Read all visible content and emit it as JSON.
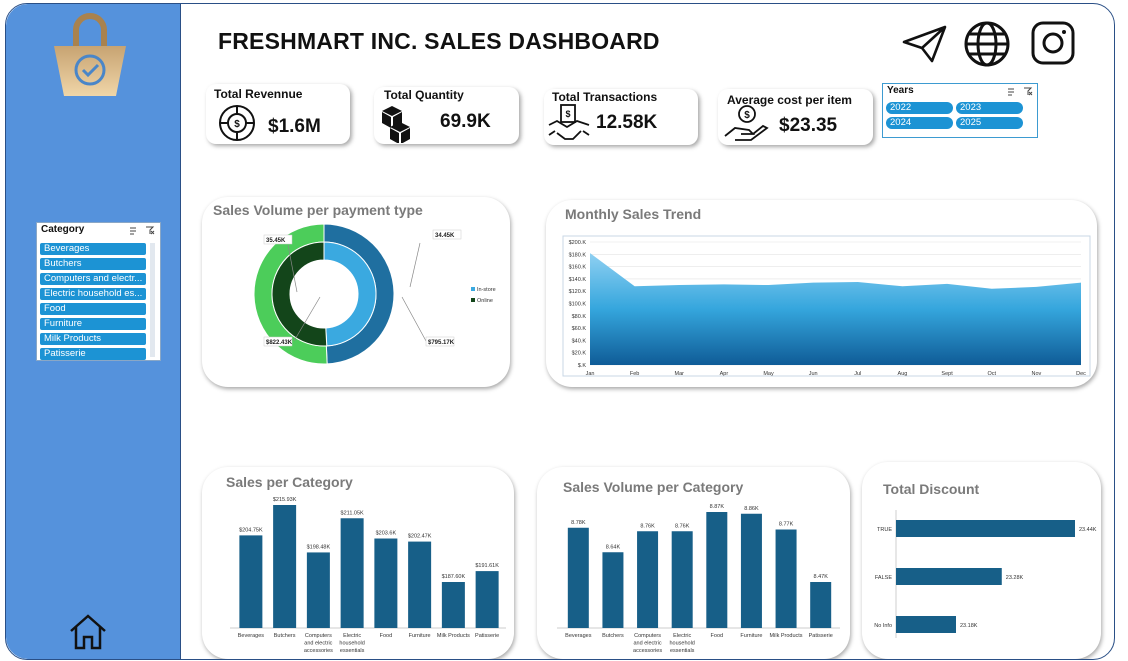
{
  "title": "FRESHMART INC. SALES DASHBOARD",
  "kpis": {
    "revenue": {
      "label": "Total Revennue",
      "value": "$1.6M"
    },
    "quantity": {
      "label": "Total Quantity",
      "value": "69.9K"
    },
    "transactions": {
      "label": "Total Transactions",
      "value": "12.58K"
    },
    "avg_cost": {
      "label": "Average cost per item",
      "value": "$23.35"
    }
  },
  "years_slicer": {
    "title": "Years",
    "items": [
      "2022",
      "2023",
      "2024",
      "2025"
    ]
  },
  "category_slicer": {
    "title": "Category",
    "items": [
      "Beverages",
      "Butchers",
      "Computers and electr...",
      "Electric household es...",
      "Food",
      "Furniture",
      "Milk Products",
      "Patisserie"
    ]
  },
  "icons": {
    "cart": "shopping-bag-icon",
    "send": "paper-plane-icon",
    "web": "globe-icon",
    "social": "instagram-icon",
    "home": "home-icon"
  },
  "colors": {
    "sidebar": "#5592dc",
    "bar": "#175f88",
    "instore": "#1f6fa0",
    "instore_light": "#3aa9e0",
    "online": "#4ccd5a",
    "online_dark": "#13451a"
  },
  "chart_data": [
    {
      "id": "payment",
      "type": "pie",
      "title": "Sales Volume per payment type",
      "legend": [
        "In-store",
        "Online"
      ],
      "legend_position": "right",
      "outer_ring": {
        "name": "volume",
        "values": [
          34.45,
          35.45
        ],
        "labels": [
          "34.45K",
          "35.45K"
        ]
      },
      "inner_ring": {
        "name": "sales",
        "values": [
          795.17,
          822.43
        ],
        "labels": [
          "$795.17K",
          "$822.43K"
        ]
      }
    },
    {
      "id": "trend",
      "type": "area",
      "title": "Monthly Sales Trend",
      "categories": [
        "Jan",
        "Feb",
        "Mar",
        "Apr",
        "May",
        "Jun",
        "Jul",
        "Aug",
        "Sept",
        "Oct",
        "Nov",
        "Dec"
      ],
      "values": [
        182,
        128,
        130,
        131,
        130,
        134,
        135,
        128,
        132,
        124,
        127,
        134
      ],
      "ylim": [
        0,
        200
      ],
      "yticks": [
        "$.K",
        "$20.K",
        "$40.K",
        "$60.K",
        "$80.K",
        "$100.K",
        "$120.K",
        "$140.K",
        "$160.K",
        "$180.K",
        "$200.K"
      ],
      "grid": true
    },
    {
      "id": "salescat",
      "type": "bar",
      "title": "Sales per Category",
      "categories": [
        "Beverages",
        "Butchers",
        "Computers and electric accessories",
        "Electric household essentials",
        "Food",
        "Furniture",
        "Milk Products",
        "Patisserie"
      ],
      "values": [
        204.75,
        215.93,
        198.48,
        211.05,
        203.6,
        202.47,
        187.6,
        191.61
      ],
      "labels": [
        "$204.75K",
        "$215.93K",
        "$198.48K",
        "$211.05K",
        "$203.6K",
        "$202.47K",
        "$187.60K",
        "$191.61K"
      ]
    },
    {
      "id": "volcat",
      "type": "bar",
      "title": "Sales Volume per Category",
      "categories": [
        "Beverages",
        "Butchers",
        "Computers and electric accessories",
        "Electric household essentials",
        "Food",
        "Furniture",
        "Milk Products",
        "Patisserie"
      ],
      "values": [
        8.78,
        8.64,
        8.76,
        8.76,
        8.87,
        8.86,
        8.77,
        8.47
      ],
      "labels": [
        "8.78K",
        "8.64K",
        "8.76K",
        "8.76K",
        "8.87K",
        "8.86K",
        "8.77K",
        "8.47K"
      ]
    },
    {
      "id": "discount",
      "type": "bar",
      "orientation": "horizontal",
      "title": "Total Discount",
      "categories": [
        "TRUE",
        "FALSE",
        "No Info"
      ],
      "values": [
        23.44,
        23.28,
        23.18
      ],
      "labels": [
        "23.44K",
        "23.28K",
        "23.18K"
      ]
    }
  ]
}
